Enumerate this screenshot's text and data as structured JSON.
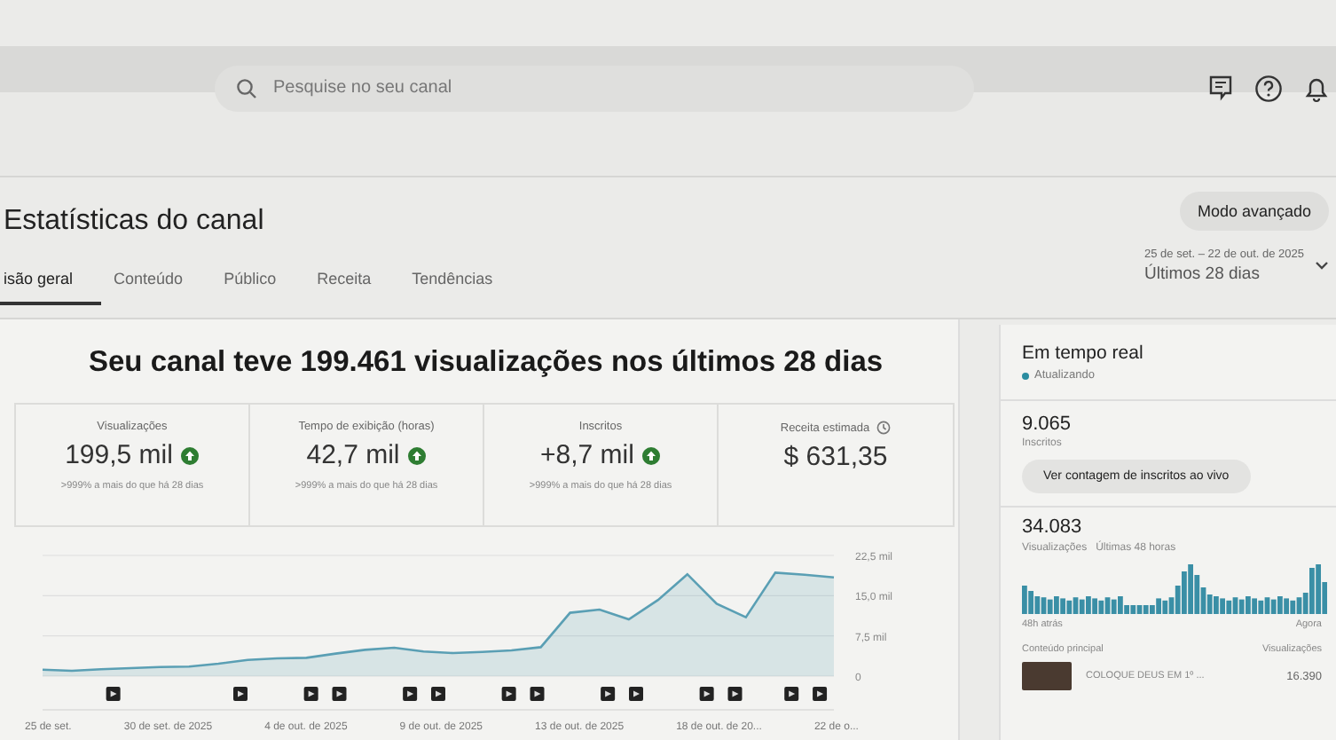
{
  "header": {
    "search": {
      "placeholder": "Pesquise no seu canal"
    }
  },
  "page": {
    "title": "Estatísticas do canal",
    "mode_button": "Modo avançado",
    "date_range": "25 de set. – 22 de out. de 2025",
    "period": "Últimos 28 dias"
  },
  "tabs": [
    {
      "label": "isão geral",
      "selected": true
    },
    {
      "label": "Conteúdo",
      "selected": false
    },
    {
      "label": "Público",
      "selected": false
    },
    {
      "label": "Receita",
      "selected": false
    },
    {
      "label": "Tendências",
      "selected": false
    }
  ],
  "summary": {
    "headline": "Seu canal teve 199.461 visualizações nos últimos 28 dias",
    "metrics": [
      {
        "label": "Visualizações",
        "value": "199,5 mil",
        "increase": true,
        "comparison": ">999% a mais do que há 28 dias",
        "info": false
      },
      {
        "label": "Tempo de exibição (horas)",
        "value": "42,7 mil",
        "increase": true,
        "comparison": ">999% a mais do que há 28 dias",
        "info": false
      },
      {
        "label": "Inscritos",
        "value": "+8,7 mil",
        "increase": true,
        "comparison": ">999% a mais do que há 28 dias",
        "info": false
      },
      {
        "label": "Receita estimada",
        "value": "$ 631,35",
        "increase": false,
        "info": true
      }
    ],
    "chart_data": {
      "type": "area",
      "series": [
        {
          "color": "#5a9fb4",
          "values": [
            1.2,
            1.0,
            1.3,
            1.5,
            1.7,
            1.8,
            2.3,
            3.0,
            3.3,
            3.4,
            4.2,
            4.9,
            5.3,
            4.6,
            4.3,
            4.5,
            4.8,
            5.4,
            11.8,
            12.4,
            10.6,
            14.2,
            19.0,
            13.5,
            11.0,
            19.3,
            18.9,
            18.4
          ]
        }
      ],
      "ylim": [
        0,
        22.5
      ],
      "yticks": [
        {
          "value": 0,
          "label": "0"
        },
        {
          "value": 7.5,
          "label": "7,5 mil"
        },
        {
          "value": 15,
          "label": "15,0 mil"
        },
        {
          "value": 22.5,
          "label": "22,5 mil"
        }
      ]
    },
    "x_axis_labels": [
      "25 de set.",
      "30 de set. de 2025",
      "4 de out. de 2025",
      "9 de out. de 2025",
      "13 de out. de 2025",
      "18 de out. de 20...",
      "22 de o..."
    ]
  },
  "realtime": {
    "title": "Em tempo real",
    "status": "Atualizando",
    "subscribers": "9.065",
    "subscribers_label": "Inscritos",
    "live_button": "Ver contagem de inscritos ao vivo",
    "views": "34.083",
    "views_label": "Visualizações",
    "views_period": "Últimas 48 horas",
    "axis_start": "48h atrás",
    "axis_end": "Agora",
    "top_content": {
      "column_1": "Conteúdo principal",
      "column_2": "Visualizações",
      "rows": [
        {
          "title": "COLOQUE DEUS EM 1º ...",
          "views": "16.390"
        }
      ]
    }
  }
}
